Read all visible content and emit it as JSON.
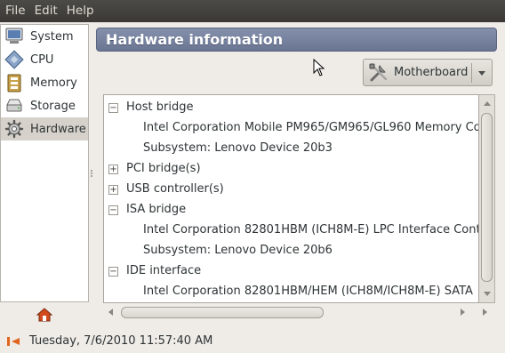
{
  "menubar": {
    "items": [
      {
        "label": "File"
      },
      {
        "label": "Edit"
      },
      {
        "label": "Help"
      }
    ]
  },
  "sidebar": {
    "items": [
      {
        "label": "System",
        "icon": "computer-icon",
        "selected": false
      },
      {
        "label": "CPU",
        "icon": "cpu-icon",
        "selected": false
      },
      {
        "label": "Memory",
        "icon": "memory-icon",
        "selected": false
      },
      {
        "label": "Storage",
        "icon": "storage-icon",
        "selected": false
      },
      {
        "label": "Hardware",
        "icon": "hardware-icon",
        "selected": true
      }
    ]
  },
  "header": {
    "title": "Hardware information"
  },
  "device_selector": {
    "selected": "Motherboard",
    "icon": "motherboard-tools-icon"
  },
  "tree": {
    "rows": [
      {
        "text": "Host bridge",
        "level": 0,
        "expander": "−"
      },
      {
        "text": "Intel Corporation Mobile PM965/GM965/GL960 Memory Co",
        "level": 1
      },
      {
        "text": "Subsystem: Lenovo Device 20b3",
        "level": 1
      },
      {
        "text": "PCI bridge(s)",
        "level": 0,
        "expander": "+"
      },
      {
        "text": "USB controller(s)",
        "level": 0,
        "expander": "+"
      },
      {
        "text": "ISA bridge",
        "level": 0,
        "expander": "−"
      },
      {
        "text": "Intel Corporation 82801HBM (ICH8M-E) LPC Interface Cont",
        "level": 1
      },
      {
        "text": "Subsystem: Lenovo Device 20b6",
        "level": 1
      },
      {
        "text": "IDE interface",
        "level": 0,
        "expander": "−"
      },
      {
        "text": "Intel Corporation 82801HBM/HEM (ICH8M/ICH8M-E) SATA",
        "level": 1
      }
    ]
  },
  "statusbar": {
    "text": "Tuesday, 7/6/2010 11:57:40 AM",
    "icon": "clock-arrow-icon"
  },
  "colors": {
    "title_bar": "#7783a0",
    "selection": "#d6d2cb",
    "accent": "#e0651e"
  }
}
